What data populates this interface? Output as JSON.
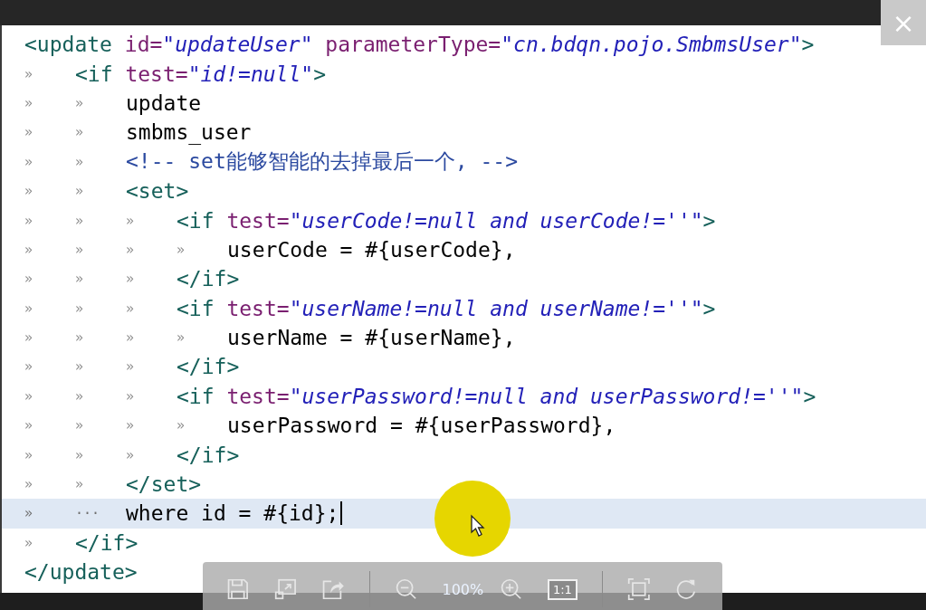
{
  "close_button": {
    "label": "×"
  },
  "lines": [
    {
      "current": false,
      "tokens": [
        {
          "kind": "tag",
          "text": "<update"
        },
        {
          "kind": "attr",
          "text": " id="
        },
        {
          "kind": "value",
          "text": "\"updateUser\""
        },
        {
          "kind": "attr",
          "text": " parameterType="
        },
        {
          "kind": "value",
          "text": "\"cn.bdqn.pojo.SmbmsUser\""
        },
        {
          "kind": "tag",
          "text": ">"
        }
      ]
    },
    {
      "guides": [
        "»"
      ],
      "current": false,
      "tokens": [
        {
          "kind": "tag",
          "text": "<if"
        },
        {
          "kind": "attr",
          "text": " test="
        },
        {
          "kind": "value",
          "text": "\"id!=null\""
        },
        {
          "kind": "tag",
          "text": ">"
        }
      ]
    },
    {
      "guides": [
        "»",
        "»"
      ],
      "current": false,
      "tokens": [
        {
          "kind": "text",
          "text": "update"
        }
      ]
    },
    {
      "guides": [
        "»",
        "»"
      ],
      "current": false,
      "tokens": [
        {
          "kind": "text",
          "text": "smbms_user"
        }
      ]
    },
    {
      "guides": [
        "»",
        "»"
      ],
      "current": false,
      "tokens": [
        {
          "kind": "comment",
          "text": "<!-- set能够智能的去掉最后一个, -->"
        }
      ]
    },
    {
      "guides": [
        "»",
        "»"
      ],
      "current": false,
      "tokens": [
        {
          "kind": "tag",
          "text": "<set>"
        }
      ]
    },
    {
      "guides": [
        "»",
        "»",
        "»"
      ],
      "current": false,
      "tokens": [
        {
          "kind": "tag",
          "text": "<if"
        },
        {
          "kind": "attr",
          "text": " test="
        },
        {
          "kind": "value",
          "text": "\"userCode!=null and userCode!=''\""
        },
        {
          "kind": "tag",
          "text": ">"
        }
      ]
    },
    {
      "guides": [
        "»",
        "»",
        "»",
        "»"
      ],
      "current": false,
      "tokens": [
        {
          "kind": "text",
          "text": "userCode = #{userCode},"
        }
      ]
    },
    {
      "guides": [
        "»",
        "»",
        "»"
      ],
      "current": false,
      "tokens": [
        {
          "kind": "tag",
          "text": "</if>"
        }
      ]
    },
    {
      "guides": [
        "»",
        "»",
        "»"
      ],
      "current": false,
      "tokens": [
        {
          "kind": "tag",
          "text": "<if"
        },
        {
          "kind": "attr",
          "text": " test="
        },
        {
          "kind": "value",
          "text": "\"userName!=null and userName!=''\""
        },
        {
          "kind": "tag",
          "text": ">"
        }
      ]
    },
    {
      "guides": [
        "»",
        "»",
        "»",
        "»"
      ],
      "current": false,
      "tokens": [
        {
          "kind": "text",
          "text": "userName = #{userName},"
        }
      ]
    },
    {
      "guides": [
        "»",
        "»",
        "»"
      ],
      "current": false,
      "tokens": [
        {
          "kind": "tag",
          "text": "</if>"
        }
      ]
    },
    {
      "guides": [
        "»",
        "»",
        "»"
      ],
      "current": false,
      "tokens": [
        {
          "kind": "tag",
          "text": "<if"
        },
        {
          "kind": "attr",
          "text": " test="
        },
        {
          "kind": "value",
          "text": "\"userPassword!=null and userPassword!=''\""
        },
        {
          "kind": "tag",
          "text": ">"
        }
      ]
    },
    {
      "guides": [
        "»",
        "»",
        "»",
        "»"
      ],
      "current": false,
      "tokens": [
        {
          "kind": "text",
          "text": "userPassword = #{userPassword},"
        }
      ]
    },
    {
      "guides": [
        "»",
        "»",
        "»"
      ],
      "current": false,
      "tokens": [
        {
          "kind": "tag",
          "text": "</if>"
        }
      ]
    },
    {
      "guides": [
        "»",
        "»"
      ],
      "current": false,
      "tokens": [
        {
          "kind": "tag",
          "text": "</set>"
        }
      ]
    },
    {
      "guides": [
        "»",
        "···"
      ],
      "current": true,
      "tokens": [
        {
          "kind": "text",
          "text": "where id = #{id};"
        }
      ]
    },
    {
      "guides": [
        "»"
      ],
      "current": false,
      "tokens": [
        {
          "kind": "tag",
          "text": "</if>"
        }
      ]
    },
    {
      "current": false,
      "tokens": [
        {
          "kind": "tag",
          "text": "</update>"
        }
      ]
    }
  ],
  "toolbar": {
    "zoom": "100%",
    "actual_size": "1:1"
  }
}
